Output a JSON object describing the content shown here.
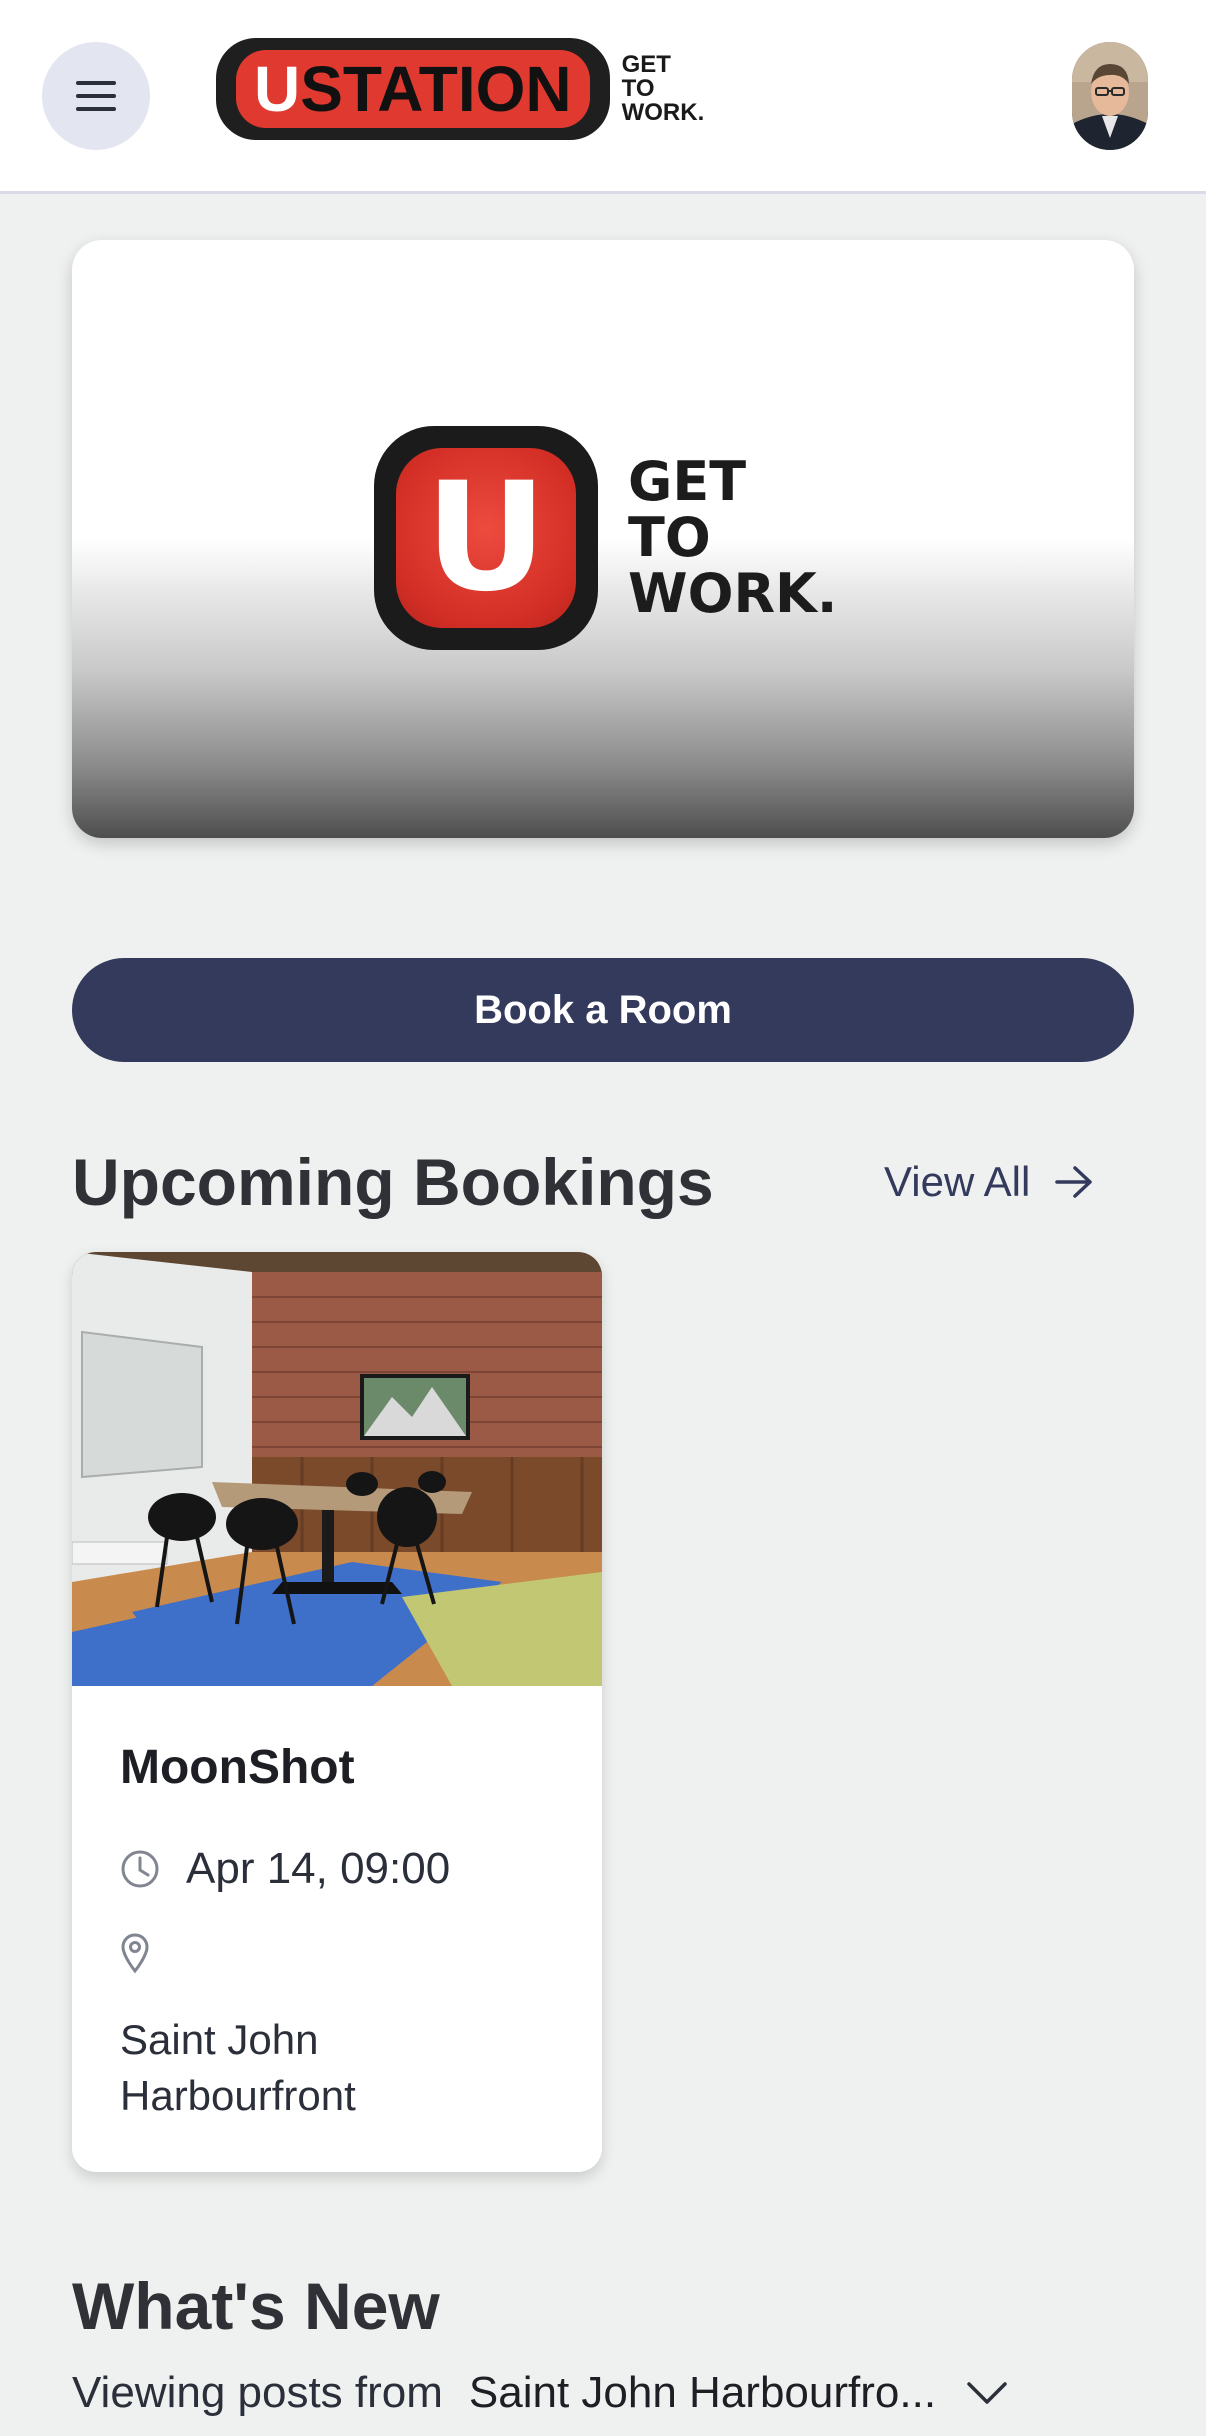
{
  "header": {
    "menu_icon": "hamburger-menu-icon",
    "brand": {
      "word_first": "U",
      "word_rest": "STATION",
      "tag": [
        "GET",
        "TO",
        "WORK."
      ]
    },
    "avatar_icon": "user-avatar"
  },
  "hero": {
    "mark_letter": "U",
    "tag": [
      "GET",
      "TO",
      "WORK."
    ]
  },
  "book_button": {
    "label": "Book a Room"
  },
  "upcoming": {
    "title": "Upcoming Bookings",
    "view_all": "View All",
    "bookings": [
      {
        "name": "MoonShot",
        "time": "Apr 14, 09:00",
        "location": "Saint John Harbourfront"
      }
    ]
  },
  "whats_new": {
    "title": "What's New",
    "posts_label": "Viewing posts from",
    "posts_location": "Saint John Harbourfro..."
  },
  "colors": {
    "primary": "#333a5c",
    "brand_red": "#e03a30",
    "background": "#eff1f0"
  }
}
